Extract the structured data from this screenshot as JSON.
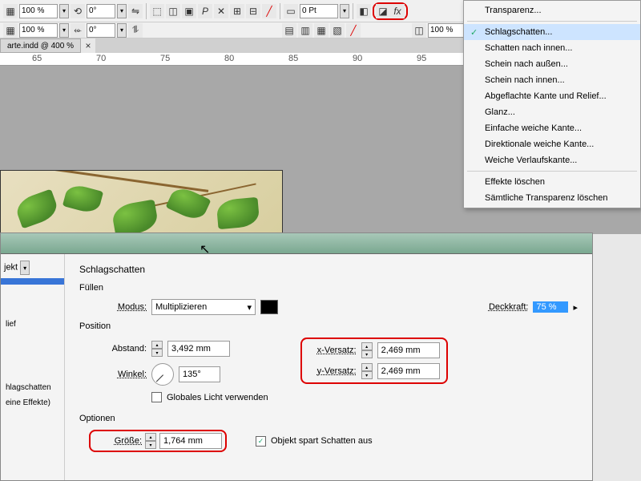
{
  "toolbar": {
    "zoom1": "100 %",
    "angle1": "0°",
    "pt_field": "0 Pt",
    "zoom2": "100 %",
    "angle2": "0°"
  },
  "doc_tab": "arte.indd @ 400 %",
  "ruler_ticks": [
    "65",
    "70",
    "75",
    "80",
    "85",
    "90",
    "95"
  ],
  "context_menu": {
    "items": [
      {
        "label": "Transparenz...",
        "checked": false
      },
      {
        "sep": true
      },
      {
        "label": "Schlagschatten...",
        "checked": true,
        "hl": true
      },
      {
        "label": "Schatten nach innen...",
        "checked": false
      },
      {
        "label": "Schein nach außen...",
        "checked": false
      },
      {
        "label": "Schein nach innen...",
        "checked": false
      },
      {
        "label": "Abgeflachte Kante und Relief...",
        "checked": false
      },
      {
        "label": "Glanz...",
        "checked": false
      },
      {
        "label": "Einfache weiche Kante...",
        "checked": false
      },
      {
        "label": "Direktionale weiche Kante...",
        "checked": false
      },
      {
        "label": "Weiche Verlaufskante...",
        "checked": false
      },
      {
        "sep": true
      },
      {
        "label": "Effekte löschen",
        "checked": false
      },
      {
        "label": "Sämtliche Transparenz löschen",
        "checked": false
      }
    ]
  },
  "dialog": {
    "left_target_label": "jekt",
    "left_items": [
      "",
      "lief",
      "",
      "hlagschatten",
      "eine Effekte)"
    ],
    "title": "Schlagschatten",
    "fill_section": "Füllen",
    "mode_label": "Modus:",
    "mode_value": "Multiplizieren",
    "opacity_label": "Deckkraft:",
    "opacity_value": "75 %",
    "position_section": "Position",
    "abstand_label": "Abstand:",
    "abstand_value": "3,492 mm",
    "winkel_label": "Winkel:",
    "winkel_value": "135°",
    "xversatz_label": "x-Versatz:",
    "xversatz_value": "2,469 mm",
    "yversatz_label": "y-Versatz:",
    "yversatz_value": "2,469 mm",
    "global_light": "Globales Licht verwenden",
    "options_section": "Optionen",
    "groesse_label": "Größe:",
    "groesse_value": "1,764 mm",
    "spart_schatten": "Objekt spart Schatten aus",
    "spart_checked": "✓"
  }
}
